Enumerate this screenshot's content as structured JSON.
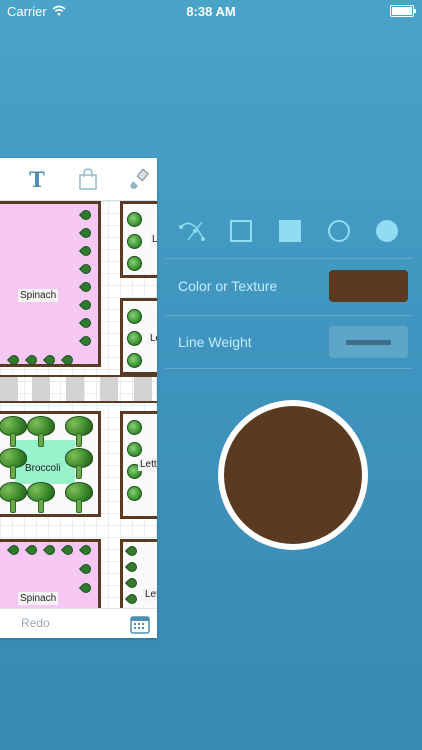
{
  "status_bar": {
    "carrier": "Carrier",
    "time": "8:38 AM"
  },
  "garden": {
    "beds": [
      {
        "label": "Spinach"
      },
      {
        "label": "Le"
      },
      {
        "label": "Le"
      },
      {
        "label": "Broccoli"
      },
      {
        "label": "Lettu"
      },
      {
        "label": "Spinach"
      },
      {
        "label": "Let"
      }
    ],
    "toolbar": {
      "text_tool_glyph": "T"
    },
    "footer": {
      "redo_label": "Redo"
    }
  },
  "properties": {
    "color_or_texture_label": "Color or Texture",
    "line_weight_label": "Line Weight",
    "current_color": "#5a3a20"
  },
  "colors": {
    "background": "#4199c2",
    "accent": "#8fdcf3",
    "garden_border": "#5a3a22",
    "spinach_bed": "#f6c7f3"
  }
}
